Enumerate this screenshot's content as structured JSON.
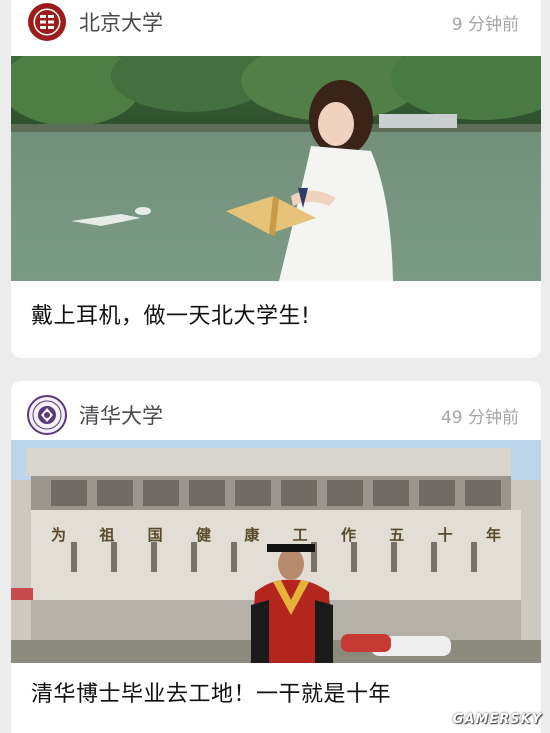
{
  "feed": {
    "posts": [
      {
        "source": "北京大学",
        "time": "9 分钟前",
        "logo_icon": "peking-university-seal-icon",
        "logo_color": "#9b1c1c",
        "photo": "photo-woman-reading-by-lake",
        "caption": "戴上耳机，做一天北大学生!"
      },
      {
        "source": "清华大学",
        "time": "49 分钟前",
        "logo_icon": "tsinghua-university-seal-icon",
        "logo_color": "#5b3a7a",
        "photo": "photo-graduate-in-front-of-building",
        "building_sign": [
          "为",
          "祖",
          "国",
          "健",
          "康",
          "工",
          "作",
          "五",
          "十",
          "年"
        ],
        "caption": "清华博士毕业去工地！一干就是十年"
      }
    ]
  },
  "watermark": "GAMERSKY"
}
